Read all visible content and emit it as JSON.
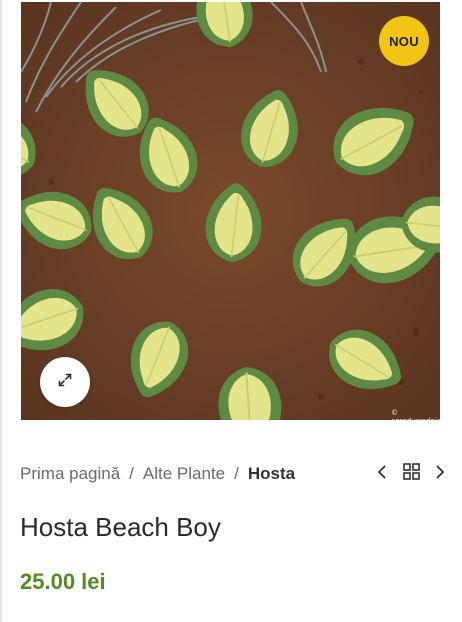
{
  "product": {
    "badge": "NOU",
    "image_credit": "© ogrodysrodnie.pl",
    "title": "Hosta Beach Boy",
    "price": "25.00 lei"
  },
  "breadcrumb": {
    "items": [
      "Prima pagină",
      "Alte Plante"
    ],
    "separator": "/",
    "current": "Hosta"
  },
  "icons": {
    "zoom": "expand-arrows-icon",
    "prev": "chevron-left-icon",
    "grid": "grid-icon",
    "next": "chevron-right-icon"
  },
  "colors": {
    "badge": "#f3c316",
    "price": "#4f8f1f",
    "soil": "#6b3f26"
  }
}
